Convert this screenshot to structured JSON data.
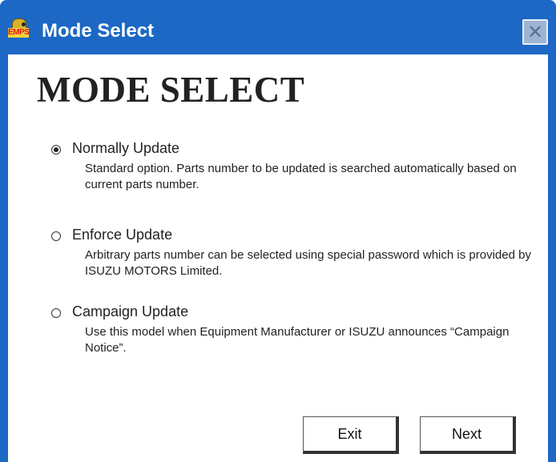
{
  "window": {
    "title": "Mode Select",
    "app_icon_text": "EMPS"
  },
  "heading": "MODE SELECT",
  "options": [
    {
      "label": "Normally Update",
      "checked": true,
      "description": "Standard option.  Parts number to be updated is searched automatically based on current parts number."
    },
    {
      "label": "Enforce Update",
      "checked": false,
      "description": "Arbitrary parts number can be selected using special password which is provided by ISUZU MOTORS Limited."
    },
    {
      "label": "Campaign Update",
      "checked": false,
      "description": "Use this model when Equipment Manufacturer or ISUZU announces “Campaign Notice”."
    }
  ],
  "buttons": {
    "exit": "Exit",
    "next": "Next"
  },
  "colors": {
    "titlebar": "#1c68c4",
    "close_button": "#9fb4d4"
  },
  "icons": {
    "close": "close-icon",
    "app": "emps-key-icon"
  }
}
